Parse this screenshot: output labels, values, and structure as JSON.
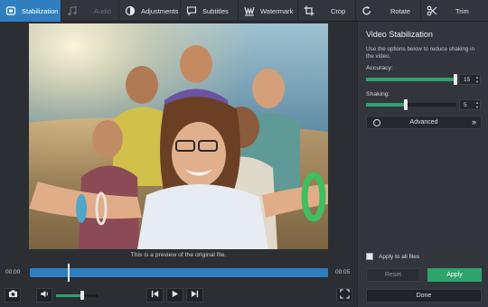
{
  "toolbar": {
    "items": [
      {
        "label": "Stabilization",
        "icon": "stabilization-icon",
        "state": "active"
      },
      {
        "label": "Audio",
        "icon": "music-note-icon",
        "state": "disabled"
      },
      {
        "label": "Adjustments",
        "icon": "contrast-icon",
        "state": "normal"
      },
      {
        "label": "Subtitles",
        "icon": "speech-bubble-icon",
        "state": "normal"
      },
      {
        "label": "Watermark",
        "icon": "watermark-icon",
        "state": "normal"
      },
      {
        "label": "Crop",
        "icon": "crop-icon",
        "state": "normal"
      },
      {
        "label": "Rotate",
        "icon": "rotate-icon",
        "state": "normal"
      },
      {
        "label": "Trim",
        "icon": "scissors-icon",
        "state": "normal"
      }
    ]
  },
  "preview": {
    "caption": "This is a preview of the original file."
  },
  "timeline": {
    "start_time": "00:00",
    "end_time": "00:05",
    "playhead_fraction": 0.13
  },
  "controls": {
    "snapshot_icon": "camera-icon",
    "volume_icon": "speaker-icon",
    "volume_level": 0.62,
    "prev_icon": "skip-back-icon",
    "play_icon": "play-icon",
    "next_icon": "skip-forward-icon",
    "fullscreen_icon": "fullscreen-icon"
  },
  "panel": {
    "title": "Video Stabilization",
    "description": "Use the options below to reduce shaking in the video.",
    "accuracy": {
      "label": "Accuracy:",
      "value": "15",
      "fraction": 0.99
    },
    "shaking": {
      "label": "Shaking:",
      "value": "5",
      "fraction": 0.44
    },
    "advanced_label": "Advanced",
    "apply_all_label": "Apply to all files",
    "reset_label": "Reset",
    "apply_label": "Apply",
    "done_label": "Done"
  },
  "colors": {
    "accent_blue": "#2f7fc0",
    "accent_green": "#2ea36c",
    "background": "#2b2e33"
  }
}
